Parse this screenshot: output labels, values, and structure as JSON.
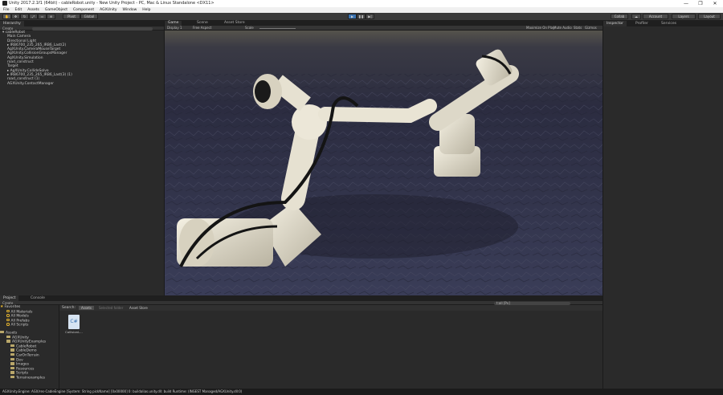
{
  "window": {
    "title": "Unity 2017.2.1f1 (64bit) - cableRobot.unity - New Unity Project - PC, Mac & Linux Standalone <DX11>",
    "controls": [
      "—",
      "❐",
      "✕"
    ]
  },
  "menubar": [
    "File",
    "Edit",
    "Assets",
    "GameObject",
    "Component",
    "AGXUnity",
    "Window",
    "Help"
  ],
  "toolbar": {
    "pivot_label": "Pivot",
    "global_label": "Global",
    "account_label": "Account",
    "layers_label": "Layers",
    "layout_label": "Layout",
    "collab_label": "Collab"
  },
  "hierarchy": {
    "tab_label": "Hierarchy",
    "create_label": "Create",
    "items": [
      {
        "label": "cableRobot",
        "indent": 0,
        "expanded": true
      },
      {
        "label": "Main Camera",
        "indent": 1
      },
      {
        "label": "Directional Light",
        "indent": 1
      },
      {
        "label": "IRB6700_235_265_IRB6_Last(2)",
        "indent": 1,
        "collapsed": true
      },
      {
        "label": "AgXUnity.CameraMouseTarget",
        "indent": 1
      },
      {
        "label": "AgXUnity.CollisionGroupsManager",
        "indent": 1
      },
      {
        "label": "AgXUnity.Simulation",
        "indent": 1
      },
      {
        "label": "road_construct",
        "indent": 1
      },
      {
        "label": "Target",
        "indent": 1
      },
      {
        "label": "AgXUnity.CollideSolve",
        "indent": 1,
        "collapsed": true
      },
      {
        "label": "IRB6700_235_265_IRB6_Last(3) (1)",
        "indent": 1,
        "collapsed": true
      },
      {
        "label": "road_construct (1)",
        "indent": 1
      },
      {
        "label": "AGXUnity.ContactManager",
        "indent": 1
      }
    ]
  },
  "scene": {
    "tabs": [
      "Game",
      "Scene",
      "Asset Store"
    ],
    "left_options": [
      "Display 1",
      "Free Aspect",
      "Scale"
    ],
    "right_options": [
      "Maximize On Play",
      "Mute Audio",
      "Stats",
      "Gizmos"
    ]
  },
  "inspector": {
    "tabs": [
      "Inspector",
      "Profiler",
      "Services"
    ]
  },
  "project": {
    "tabs": [
      "Project",
      "Console"
    ],
    "create_label": "Create",
    "search_label": "Search:",
    "search_scopes": [
      "Assets",
      "Selected folder",
      "Asset Store"
    ],
    "favorites_label": "Favorites",
    "favorites": [
      "All Materials",
      "All Models",
      "All Prefabs",
      "All Scripts"
    ],
    "assets_label": "Assets",
    "folders": [
      {
        "label": "AGXUnity",
        "indent": 1
      },
      {
        "label": "AGXUnityExamples",
        "indent": 1
      },
      {
        "label": "CableRobot",
        "indent": 2
      },
      {
        "label": "CableDemo",
        "indent": 2
      },
      {
        "label": "CarOnTerrain",
        "indent": 2
      },
      {
        "label": "Dev",
        "indent": 2
      },
      {
        "label": "Images",
        "indent": 2
      },
      {
        "label": "Resources",
        "indent": 2
      },
      {
        "label": "Scripts",
        "indent": 2
      },
      {
        "label": "Terrainexamples",
        "indent": 2
      }
    ],
    "asset_file": {
      "name": "CollisionL...",
      "ext": "C#"
    },
    "search_filter": "t:all [Pv]"
  },
  "status": {
    "text": "AGXUnity.Engine: AGX/res-CableEngine [System: String pickName] [0x00000] 0: buildalias.unity.dll: build Runtime: (INGEST Managed/AGXUnity.dll:0)"
  },
  "colors": {
    "selection_blue": "#3a72b0",
    "favorite_star": "#e8b730",
    "robot_body": "#e9e4d4",
    "robot_cable": "#141414",
    "skybox_top": "#5d5a4e",
    "terrain": "#2e2f45"
  }
}
